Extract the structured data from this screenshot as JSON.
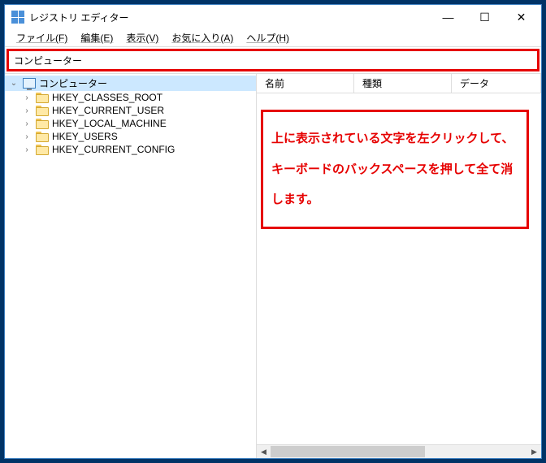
{
  "window": {
    "title": "レジストリ エディター",
    "controls": {
      "min": "—",
      "max": "☐",
      "close": "✕"
    }
  },
  "menu": {
    "file": "ファイル(F)",
    "edit": "編集(E)",
    "view": "表示(V)",
    "favorites": "お気に入り(A)",
    "help": "ヘルプ(H)"
  },
  "address": {
    "value": "コンピューター"
  },
  "tree": {
    "root": "コンピューター",
    "items": [
      "HKEY_CLASSES_ROOT",
      "HKEY_CURRENT_USER",
      "HKEY_LOCAL_MACHINE",
      "HKEY_USERS",
      "HKEY_CURRENT_CONFIG"
    ]
  },
  "columns": {
    "name": "名前",
    "type": "種類",
    "data": "データ"
  },
  "annotation": "上に表示されている文字を左クリックして、キーボードのバックスペースを押して全て消します。",
  "scroll": {
    "left": "◀",
    "right": "▶"
  }
}
